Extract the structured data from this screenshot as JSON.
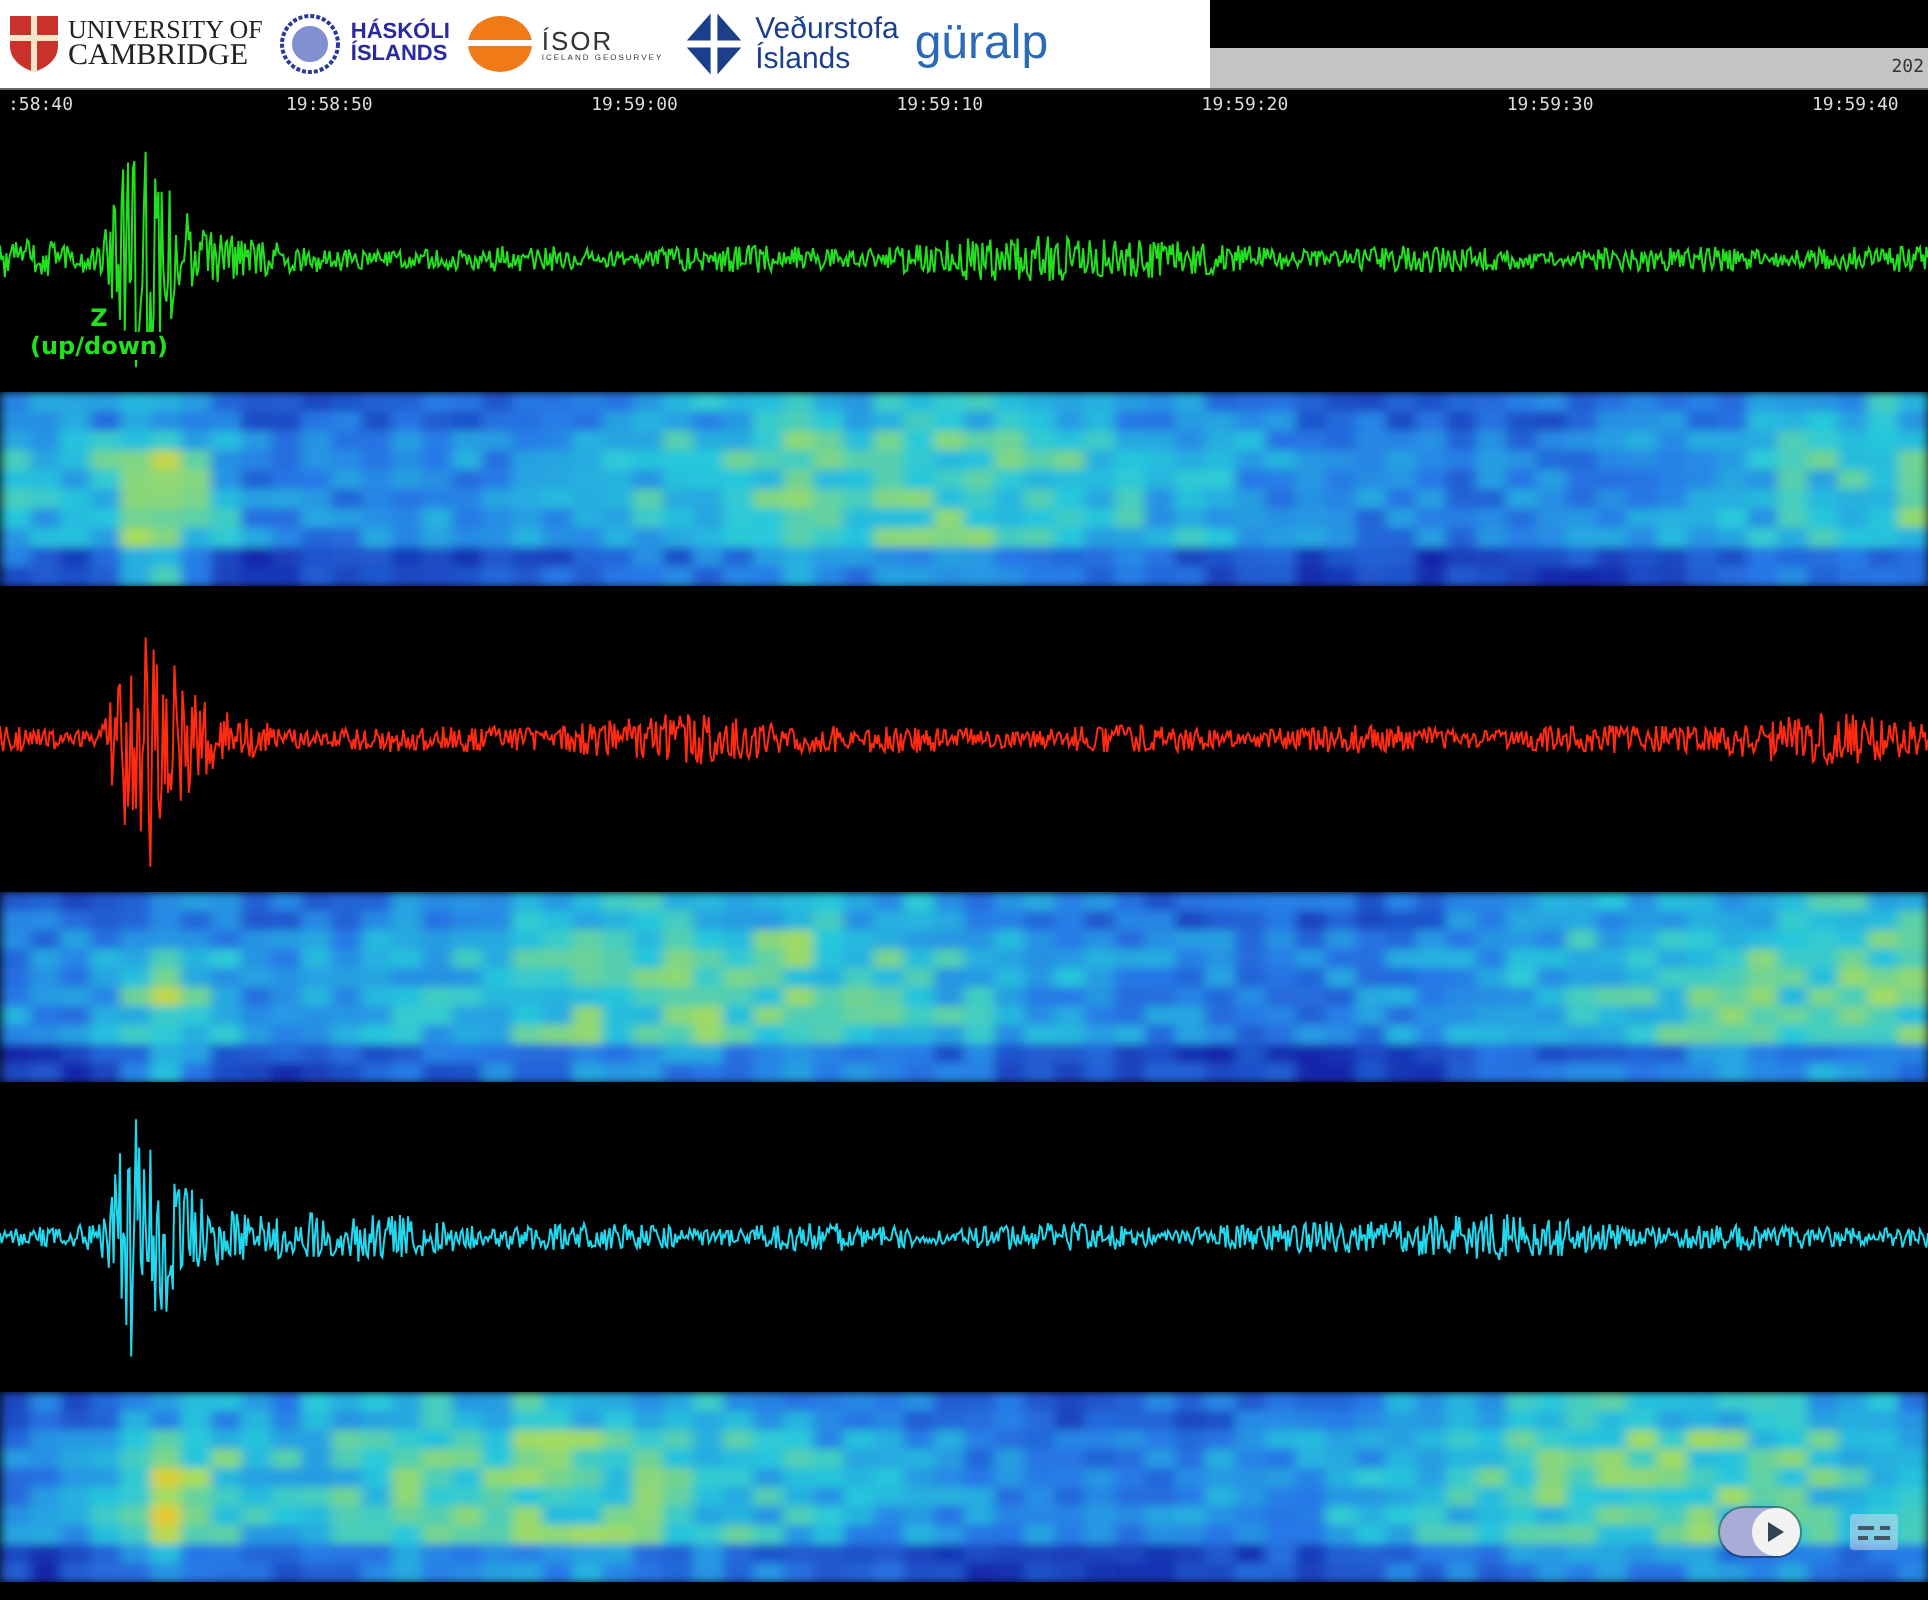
{
  "header": {
    "logos": [
      {
        "kind": "crest",
        "lines": [
          "UNIVERSITY OF",
          "CAMBRIDGE"
        ]
      },
      {
        "kind": "seal",
        "lines": [
          "HÁSKÓLI",
          "ÍSLANDS"
        ]
      },
      {
        "kind": "sun",
        "lines": [
          "ÍSOR",
          "ICELAND GEOSURVEY"
        ]
      },
      {
        "kind": "star",
        "lines": [
          "Veðurstofa",
          "Íslands"
        ]
      },
      {
        "kind": "swoosh",
        "lines": [
          "güralp"
        ]
      }
    ],
    "date_fragment": "202"
  },
  "time_axis": {
    "ticks": [
      ":58:40",
      "19:58:50",
      "19:59:00",
      "19:59:10",
      "19:59:20",
      "19:59:30",
      "19:59:40"
    ]
  },
  "channels": [
    {
      "color": "#22e01e",
      "label": "Z",
      "sublabel": "(up/down)"
    },
    {
      "color": "#ff2a10"
    },
    {
      "color": "#22d8ee"
    }
  ],
  "player_controls": {
    "autoplay": {
      "on": true
    }
  }
}
